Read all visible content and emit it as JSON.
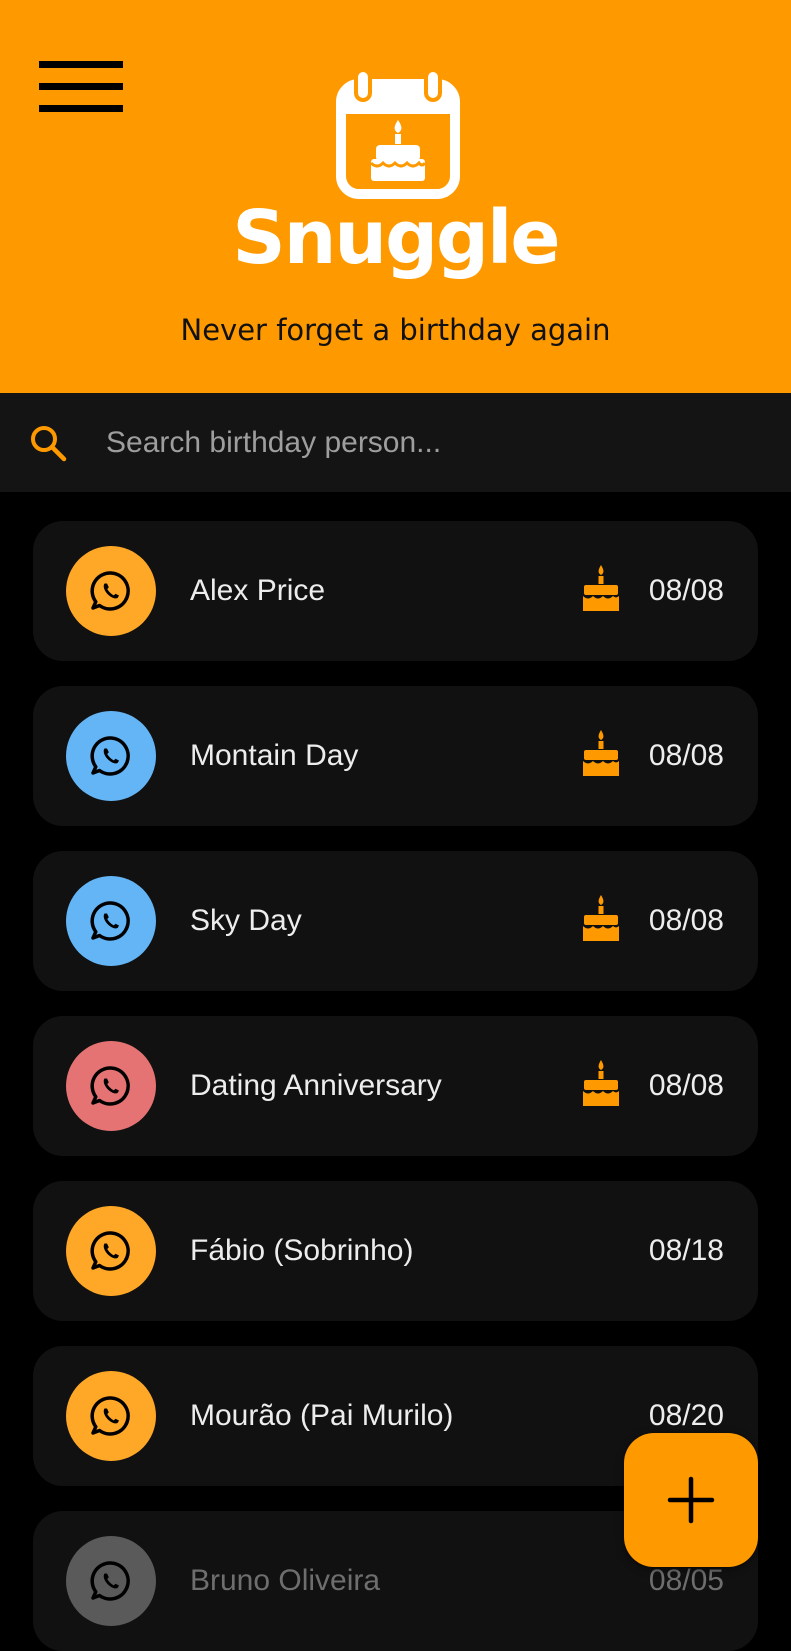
{
  "header": {
    "app_name": "Snuggle",
    "tagline": "Never forget a birthday again",
    "background_color": "#FF9900",
    "menu_icon": "hamburger-menu-icon",
    "logo_icon": "birthday-calendar-icon"
  },
  "search": {
    "placeholder": "Search birthday person...",
    "value": "",
    "icon": "search-icon",
    "icon_color": "#FF9900"
  },
  "birthdays": [
    {
      "name": "Alex Price",
      "date": "08/08",
      "today": true,
      "avatar_color": "#FFA726",
      "icon": "whatsapp-icon"
    },
    {
      "name": "Montain Day",
      "date": "08/08",
      "today": true,
      "avatar_color": "#64B5F6",
      "icon": "whatsapp-icon"
    },
    {
      "name": "Sky Day",
      "date": "08/08",
      "today": true,
      "avatar_color": "#64B5F6",
      "icon": "whatsapp-icon"
    },
    {
      "name": "Dating Anniversary",
      "date": "08/08",
      "today": true,
      "avatar_color": "#E57373",
      "icon": "whatsapp-icon"
    },
    {
      "name": "Fábio (Sobrinho)",
      "date": "08/18",
      "today": false,
      "avatar_color": "#FFA726",
      "icon": "whatsapp-icon"
    },
    {
      "name": "Mourão (Pai Murilo)",
      "date": "08/20",
      "today": false,
      "avatar_color": "#FFA726",
      "icon": "whatsapp-icon"
    },
    {
      "name": "Bruno Oliveira",
      "date": "08/05",
      "today": false,
      "past": true,
      "avatar_color": "#5A5A5A",
      "icon": "whatsapp-icon"
    }
  ],
  "fab": {
    "icon": "plus-icon",
    "color": "#FF9900"
  }
}
